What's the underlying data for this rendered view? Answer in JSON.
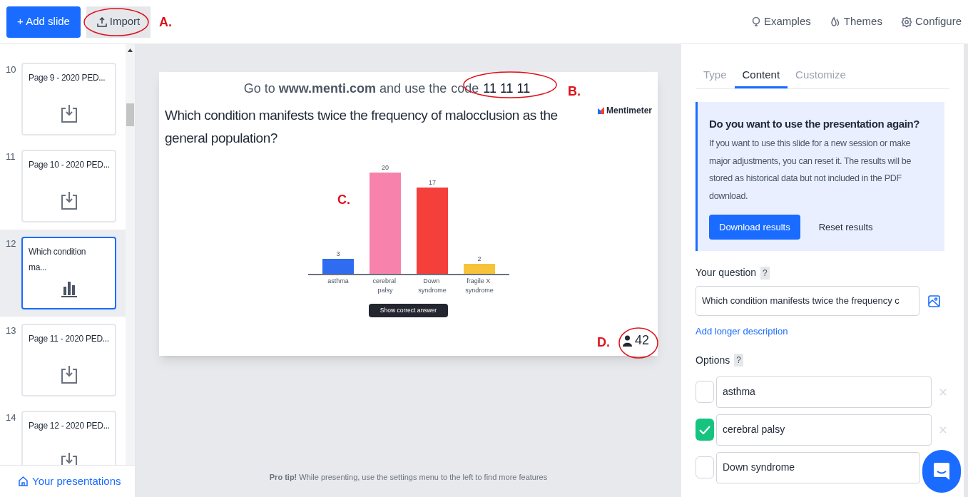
{
  "toolbar": {
    "add_slide": "+ Add slide",
    "import": "Import",
    "links": [
      {
        "label": "Examples",
        "kind": "bulb"
      },
      {
        "label": "Themes",
        "kind": "drop"
      },
      {
        "label": "Configure",
        "kind": "gear"
      }
    ]
  },
  "slides": [
    {
      "number": "10",
      "title": "Page 9 - 2020 PED...",
      "kind": "import",
      "selected": false
    },
    {
      "number": "11",
      "title": "Page 10 - 2020 PED...",
      "kind": "import",
      "selected": false
    },
    {
      "number": "12",
      "title": "Which condition ma...",
      "kind": "bar",
      "selected": true
    },
    {
      "number": "13",
      "title": "Page 11 - 2020 PED...",
      "kind": "import",
      "selected": false
    },
    {
      "number": "14",
      "title": "Page 12 - 2020 PED...",
      "kind": "import",
      "selected": false
    }
  ],
  "sidebar_footer": "Your presentations",
  "slide": {
    "instruction": "Go to **www.menti.com** and use the",
    "code_label": "code",
    "code": "11 11 11",
    "brand": "Mentimeter",
    "question": "Which condition manifests twice the frequency of malocclusion as the general population?",
    "show_answer": "Show correct answer",
    "participants": "42",
    "chart_data": {
      "type": "bar",
      "categories": [
        "asthma",
        "cerebral palsy",
        "Down syndrome",
        "fragile X syndrome"
      ],
      "values": [
        3,
        20,
        17,
        2
      ],
      "colors": [
        "#2f6cf0",
        "#f783ac",
        "#f43f3b",
        "#f6c33a"
      ],
      "data_labels": true
    }
  },
  "pro_tip": "**Pro tip!** While presenting, use the settings menu to the left to find more features",
  "panel": {
    "tabs": [
      {
        "label": "Type",
        "selected": false
      },
      {
        "label": "Content",
        "selected": true
      },
      {
        "label": "Customize",
        "selected": false
      }
    ],
    "notice": {
      "title": "Do you want to use the presentation again?",
      "body": "If you want to use this slide for a new session or make major adjustments, you can reset it. The results will be stored as historical data but not included in the PDF download.",
      "primary": "Download results",
      "secondary": "Reset results"
    },
    "question_label": "Your question",
    "help": "?",
    "question_value": "Which condition manifests twice the frequency c",
    "add_description": "Add longer description",
    "options_label": "Options",
    "options": [
      {
        "text": "asthma",
        "checked": false
      },
      {
        "text": "cerebral palsy",
        "checked": true
      },
      {
        "text": "Down syndrome",
        "checked": false
      }
    ]
  },
  "annotations": [
    "A.",
    "B.",
    "C.",
    "D."
  ]
}
